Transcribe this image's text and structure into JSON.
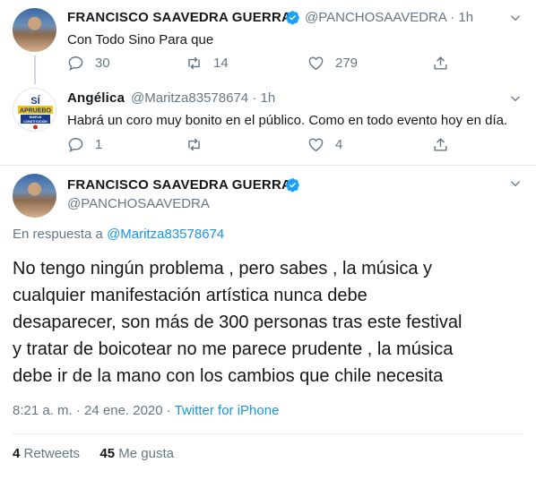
{
  "tweet1": {
    "name": "FRANCISCO SAAVEDRA GUERRA",
    "handle": "@PANCHOSAAVEDRA",
    "time": "1h",
    "text": "Con Todo Sino Para que",
    "replies": "30",
    "retweets": "14",
    "likes": "279"
  },
  "tweet2": {
    "name": "Angélica",
    "handle": "@Maritza83578674",
    "time": "1h",
    "text": "Habrá un coro muy bonito en el público. Como en todo evento hoy en día.",
    "replies": "1",
    "retweets": "",
    "likes": "4",
    "avatar_text": "SÍ APRUEBO NUEVA CONSTITUCIÓN"
  },
  "main": {
    "name": "FRANCISCO SAAVEDRA GUERRA",
    "handle": "@PANCHOSAAVEDRA",
    "reply_prefix": "En respuesta a",
    "reply_to": "@Maritza83578674",
    "text_lines": [
      "No tengo ningún problema , pero sabes , la música y",
      "cualquier manifestación artística nunca debe",
      "desaparecer, son más de 300 personas tras este festival",
      "y tratar de boicotear no me parece prudente , la música",
      "debe ir de la mano con los cambios que chile necesita"
    ],
    "timestamp": "8:21 a. m. · 24 ene. 2020 ·",
    "source": "Twitter for iPhone",
    "retweets_count": "4",
    "retweets_label": "Retweets",
    "likes_count": "45",
    "likes_label": "Me gusta"
  },
  "colors": {
    "verified": "#1da1f2",
    "link": "#1b95e0",
    "muted": "#657786"
  }
}
